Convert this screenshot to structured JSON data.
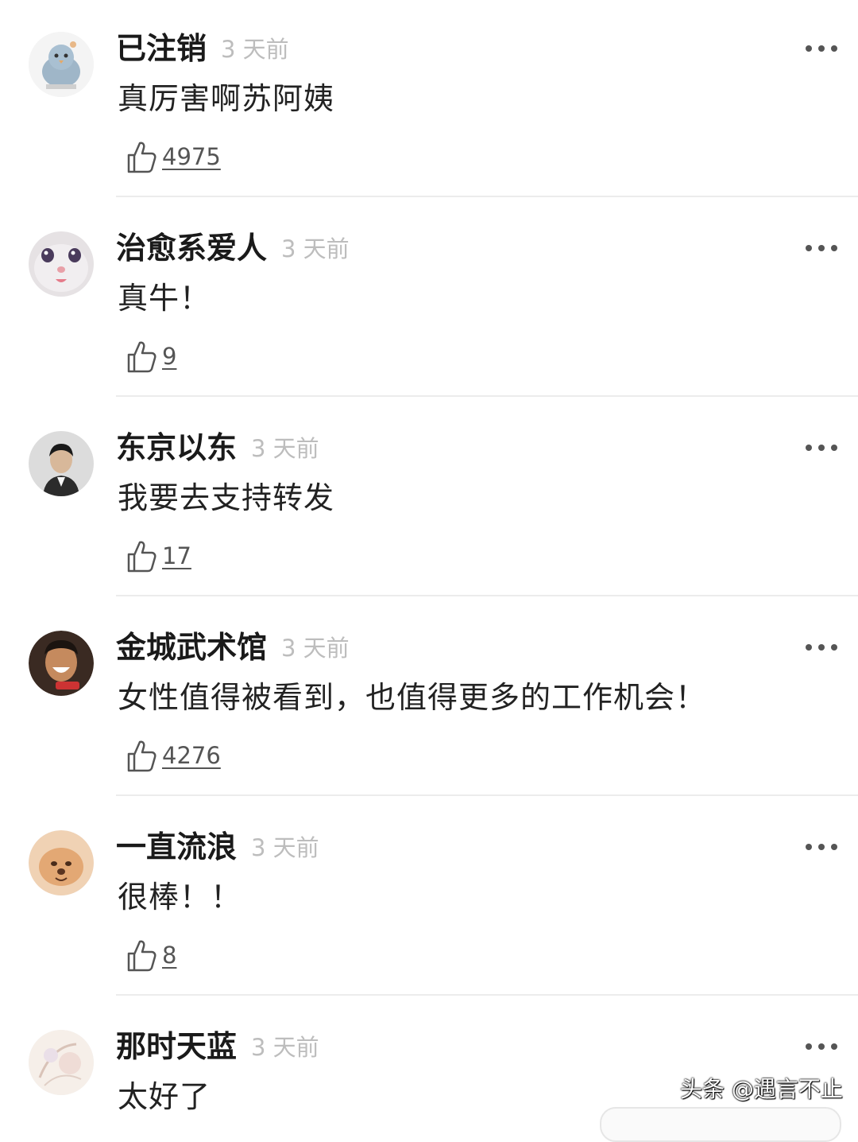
{
  "comments": [
    {
      "username": "已注销",
      "time": "3 天前",
      "content": "真厉害啊苏阿姨",
      "likes": "4975",
      "avatar_icon": "bird-sticker-avatar"
    },
    {
      "username": "治愈系爱人",
      "time": "3 天前",
      "content": "真牛！",
      "likes": "9",
      "avatar_icon": "cat-face-avatar"
    },
    {
      "username": "东京以东",
      "time": "3 天前",
      "content": "我要去支持转发",
      "likes": "17",
      "avatar_icon": "man-portrait-avatar"
    },
    {
      "username": "金城武术馆",
      "time": "3 天前",
      "content": "女性值得被看到，也值得更多的工作机会！",
      "likes": "4276",
      "avatar_icon": "laughing-man-avatar"
    },
    {
      "username": "一直流浪",
      "time": "3 天前",
      "content": "很棒！！",
      "likes": "8",
      "avatar_icon": "puppy-avatar"
    },
    {
      "username": "那时天蓝",
      "time": "3 天前",
      "content": "太好了",
      "likes": "",
      "avatar_icon": "floral-sketch-avatar"
    }
  ],
  "watermark": "头条 @遇言不止",
  "icons": {
    "like": "thumbs-up-icon",
    "more": "more-dots-icon"
  }
}
